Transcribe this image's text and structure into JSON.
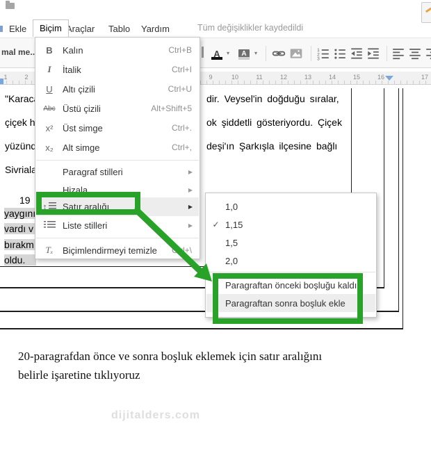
{
  "topbar": {
    "menus": [
      "Ekle",
      "Biçim",
      "Araçlar",
      "Tablo",
      "Yardım"
    ],
    "active_menu": "Biçim",
    "status": "Tüm değişiklikler kaydedildi",
    "icons": [
      "folder-icon",
      "edit-mode-pencil-icon"
    ]
  },
  "toolbar": {
    "style_dropdown": "mal me...",
    "caret": "▾",
    "text_color_glyph": "A",
    "highlight_glyph": "A",
    "icons": [
      "text-color",
      "highlight-color",
      "insert-link",
      "insert-image",
      "numbered-list",
      "bulleted-list",
      "decrease-indent",
      "increase-indent",
      "align-left",
      "align-center",
      "align-right"
    ]
  },
  "ruler": {
    "left_numbers": [
      "1",
      "2"
    ],
    "right_numbers": [
      "9",
      "10",
      "11",
      "12",
      "13",
      "14",
      "15",
      "16",
      "17"
    ]
  },
  "format_menu": {
    "submenu_arrow": "▶",
    "items": [
      {
        "glyph": "B",
        "label": "Kalın",
        "shortcut": "Ctrl+B"
      },
      {
        "glyph": "I",
        "label": "İtalik",
        "shortcut": "Ctrl+I"
      },
      {
        "glyph": "U",
        "label": "Altı çizili",
        "shortcut": "Ctrl+U"
      },
      {
        "glyph": "Abc",
        "label": "Üstü çizili",
        "shortcut": "Alt+Shift+5"
      },
      {
        "glyph": "x²",
        "label": "Üst simge",
        "shortcut": "Ctrl+."
      },
      {
        "glyph": "x₂",
        "label": "Alt simge",
        "shortcut": "Ctrl+,"
      },
      {
        "glyph": "",
        "label": "Paragraf stilleri",
        "has_submenu": true
      },
      {
        "glyph": "",
        "label": "Hizala",
        "has_submenu": true
      },
      {
        "glyph": "↕",
        "label": "Satır aralığı",
        "has_submenu": true,
        "hover": true
      },
      {
        "glyph": "",
        "label": "Liste stilleri",
        "has_submenu": true
      },
      {
        "glyph": "Tₓ",
        "label": "Biçimlendirmeyi temizle",
        "shortcut": "Ctrl+\\"
      }
    ]
  },
  "spacing_submenu": {
    "checkmark": "✓",
    "items": [
      {
        "label": "1,0"
      },
      {
        "label": "1,15",
        "checked": true
      },
      {
        "label": "1,5"
      },
      {
        "label": "2,0"
      },
      {
        "label": "Paragraftan önceki boşluğu kaldır"
      },
      {
        "label": "Paragraftan sonra boşluk ekle",
        "hover": true
      }
    ]
  },
  "document": {
    "paragraph1_left": [
      "\"Karaca",
      "çiçek h",
      "yüzünd",
      "Sivriala"
    ],
    "paragraph1_right": [
      "dir. Veysel'in doğduğu sıralar,",
      "ok şiddetli gösteriyordu. Çiçek",
      "deşi'ın Şarkışla ilçesine bağlı"
    ],
    "paragraph2_indent": "19",
    "paragraph2_selected": [
      "yaygını",
      "vardı v",
      "bırakm",
      "oldu."
    ]
  },
  "watermark": "dijitalders.com",
  "caption": {
    "line1": "20-paragrafdan önce ve sonra boşluk eklemek için satır aralığını",
    "line2": "belirle işaretine tıklıyoruz"
  },
  "colors": {
    "annotation_green": "#28a228",
    "selection_gray": "#d6d6d6",
    "ruler_marker_blue": "#7aa6dc",
    "pencil_orange": "#e8a33d"
  }
}
